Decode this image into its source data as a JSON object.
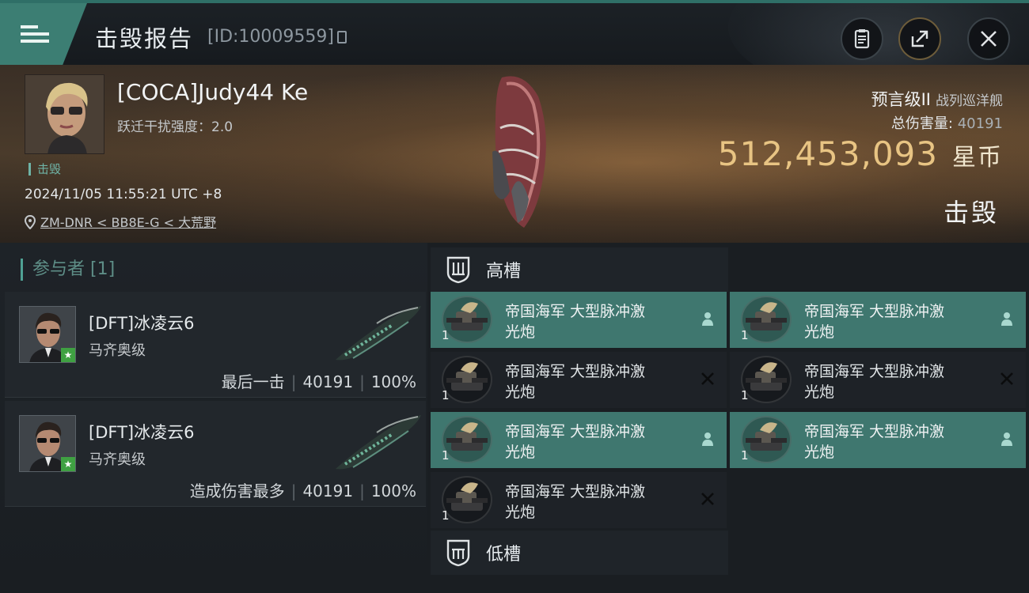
{
  "header": {
    "title": "击毁报告",
    "report_id": "[ID:10009559]"
  },
  "victim": {
    "name": "[COCA]Judy44 Ke",
    "jump_interference": "跃迁干扰强度：2.0",
    "status_tag": "击毁",
    "datetime": "2024/11/05 11:55:21 UTC +8",
    "location": "ZM-DNR < BB8E-G < 大荒野",
    "ship_name": "预言级II",
    "ship_type": "战列巡洋舰",
    "total_damage_label": "总伤害量:",
    "total_damage_value": "40191",
    "isk_value": "512,453,093",
    "isk_unit": "星币",
    "result_label": "击毁"
  },
  "participants": {
    "title": "参与者 [1]",
    "rows": [
      {
        "name": "[DFT]冰凌云6",
        "ship": "马齐奥级",
        "tag": "最后一击",
        "damage": "40191",
        "percent": "100%"
      },
      {
        "name": "[DFT]冰凌云6",
        "ship": "马齐奥级",
        "tag": "造成伤害最多",
        "damage": "40191",
        "percent": "100%"
      }
    ]
  },
  "fitting": {
    "high_slot_title": "高槽",
    "low_slot_title": "低槽",
    "modules": [
      {
        "name_line1": "帝国海军 大型脉冲激",
        "name_line2": "光炮",
        "qty": "1",
        "state": "dropped"
      },
      {
        "name_line1": "帝国海军 大型脉冲激",
        "name_line2": "光炮",
        "qty": "1",
        "state": "dropped"
      },
      {
        "name_line1": "帝国海军 大型脉冲激",
        "name_line2": "光炮",
        "qty": "1",
        "state": "destroyed"
      },
      {
        "name_line1": "帝国海军 大型脉冲激",
        "name_line2": "光炮",
        "qty": "1",
        "state": "destroyed"
      },
      {
        "name_line1": "帝国海军 大型脉冲激",
        "name_line2": "光炮",
        "qty": "1",
        "state": "dropped"
      },
      {
        "name_line1": "帝国海军 大型脉冲激",
        "name_line2": "光炮",
        "qty": "1",
        "state": "dropped"
      },
      {
        "name_line1": "帝国海军 大型脉冲激",
        "name_line2": "光炮",
        "qty": "1",
        "state": "destroyed"
      }
    ]
  },
  "colors": {
    "accent_teal": "#3f776f",
    "isk_gold": "#e8c483"
  },
  "icons": [
    "menu-icon",
    "copy-icon",
    "clipboard-icon",
    "share-icon",
    "close-icon",
    "location-pin-icon",
    "shield-slot-icon",
    "pilot-icon",
    "x-icon",
    "star-icon"
  ]
}
